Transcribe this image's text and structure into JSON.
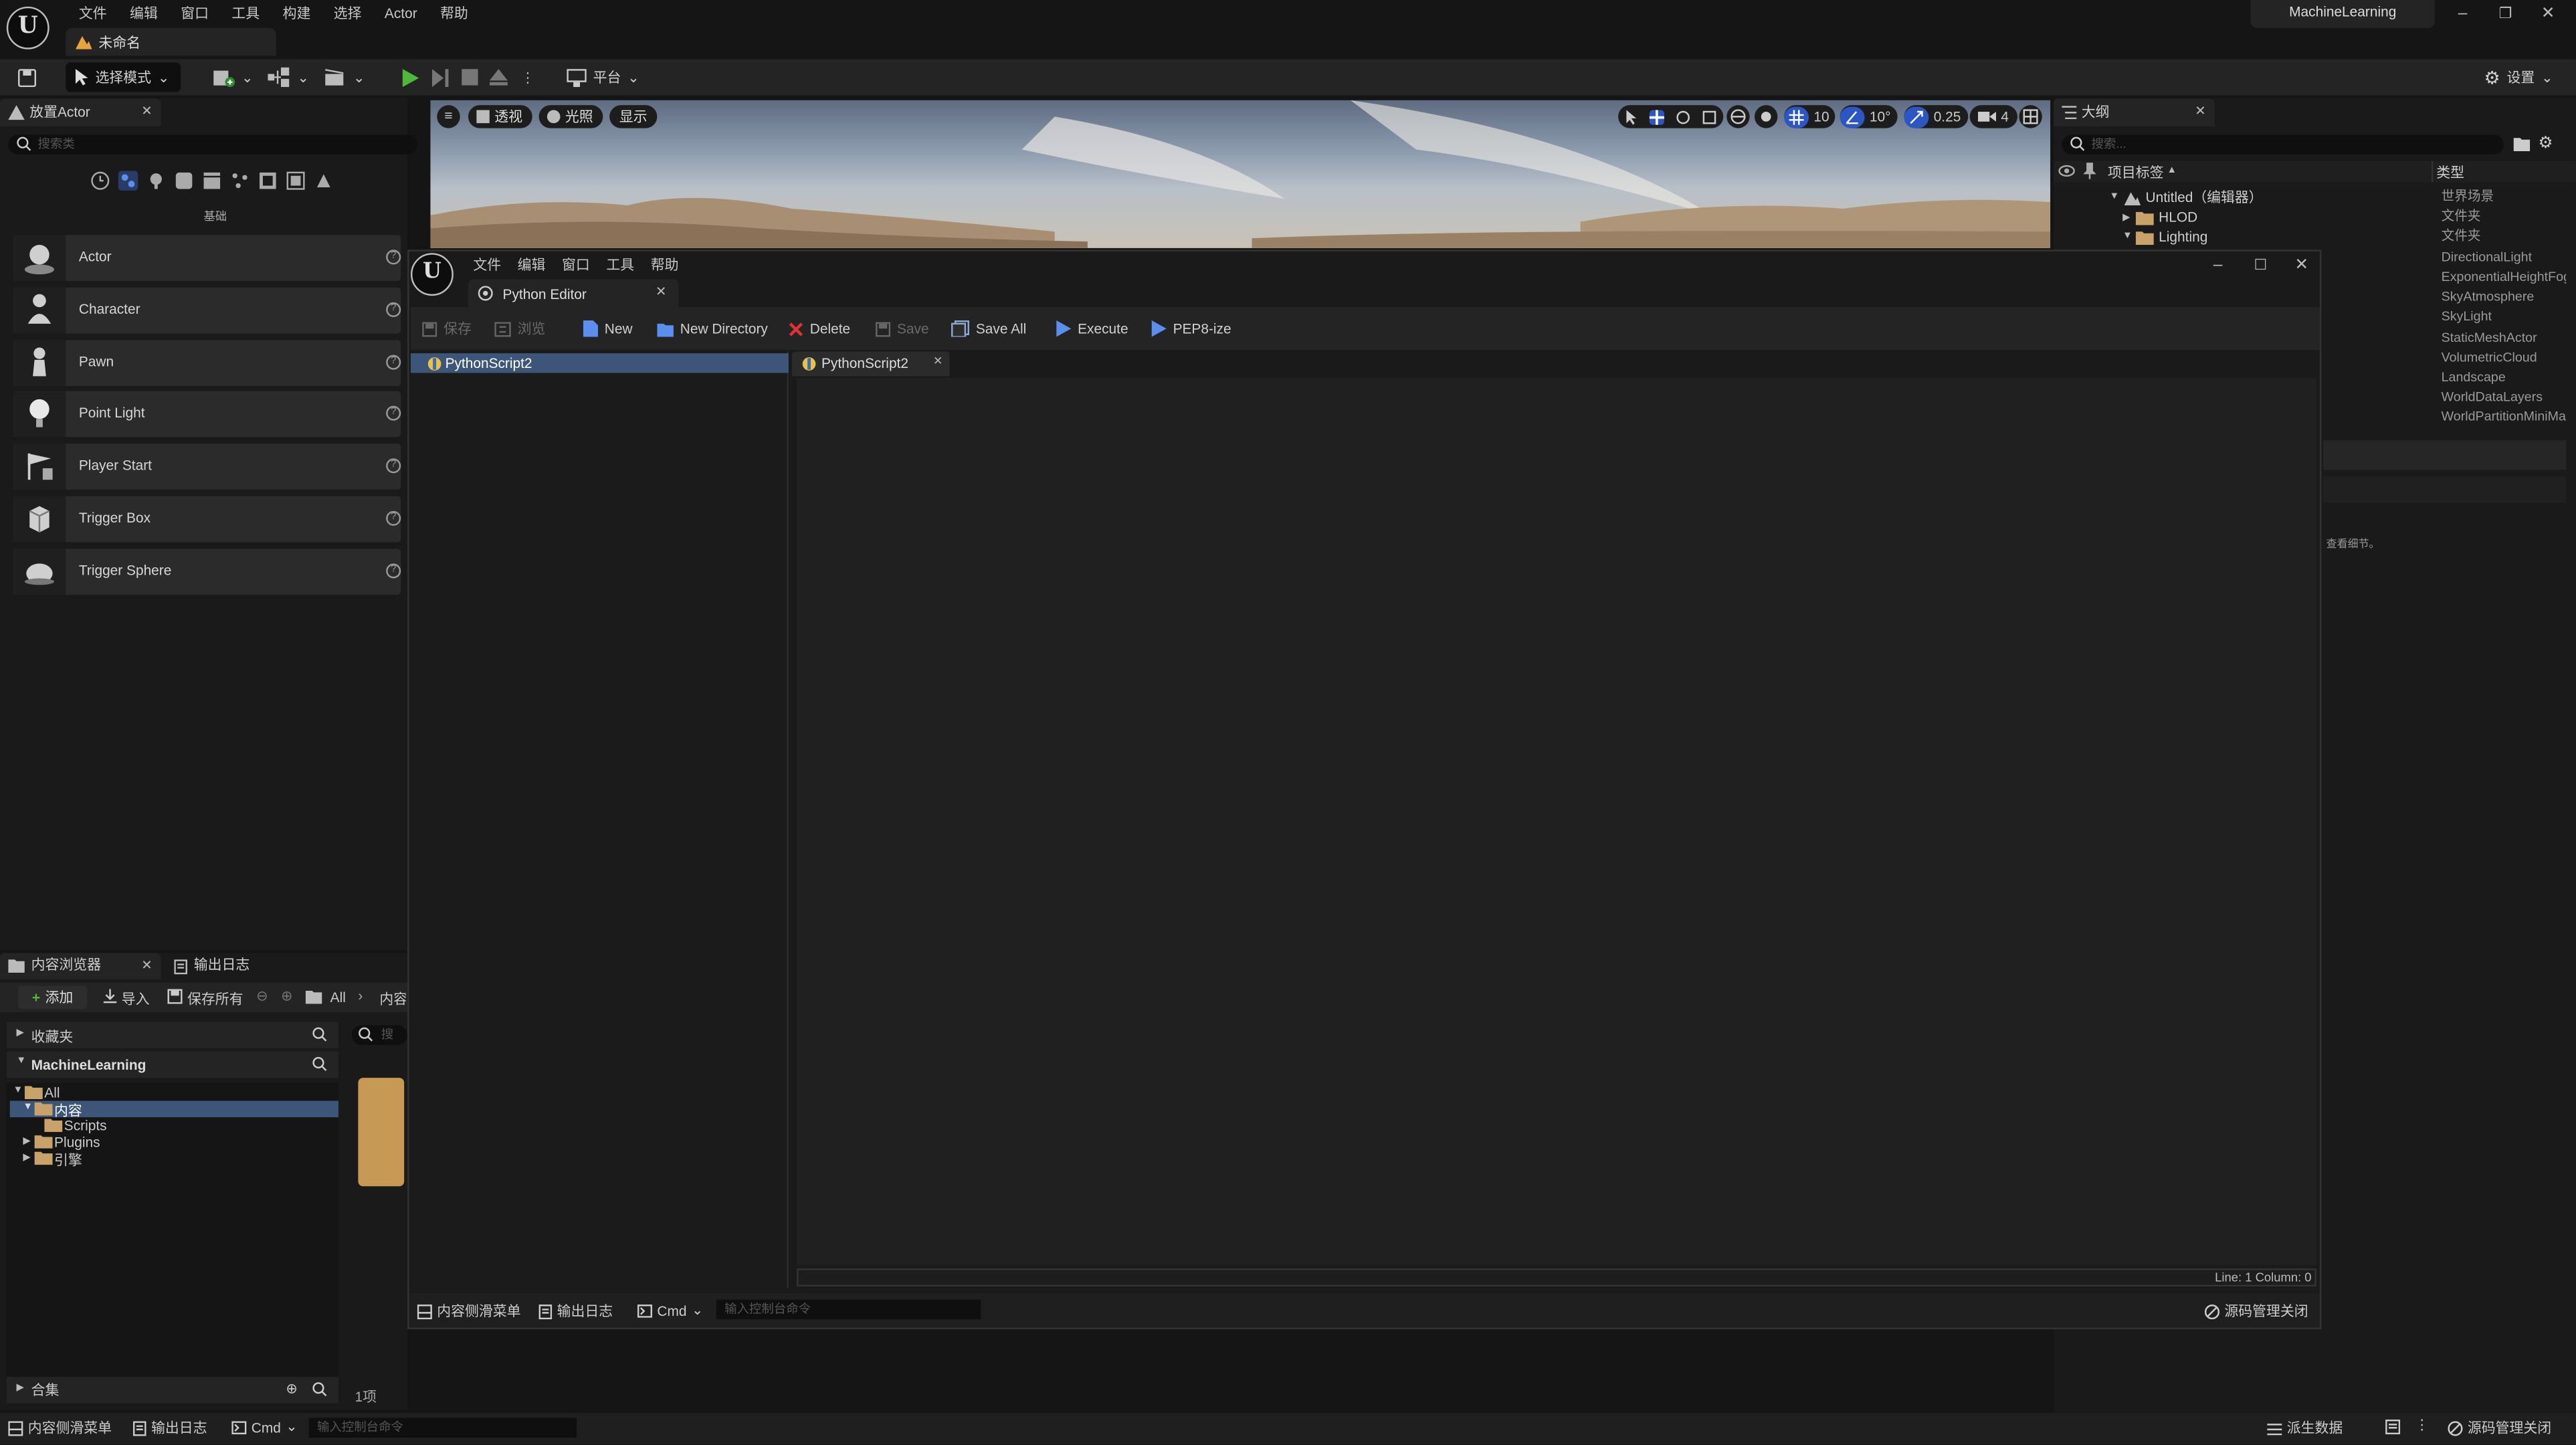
{
  "app": {
    "project_name": "MachineLearning",
    "doc_tab": "未命名"
  },
  "menu": [
    "文件",
    "编辑",
    "窗口",
    "工具",
    "构建",
    "选择",
    "Actor",
    "帮助"
  ],
  "toolbar": {
    "mode": "选择模式",
    "platform": "平台",
    "settings": "设置"
  },
  "place_actors": {
    "tab": "放置Actor",
    "search_placeholder": "搜索类",
    "category": "基础",
    "items": [
      "Actor",
      "Character",
      "Pawn",
      "Point Light",
      "Player Start",
      "Trigger Box",
      "Trigger Sphere"
    ]
  },
  "viewport": {
    "perspective": "透视",
    "lit": "光照",
    "show": "显示",
    "grid": "10",
    "angle": "10°",
    "scale": "0.25",
    "camera": "4"
  },
  "outliner": {
    "tab": "大纲",
    "search_placeholder": "搜索...",
    "col_label": "项目标签",
    "col_type": "类型",
    "rows": [
      {
        "label": "Untitled（编辑器）",
        "type": "世界场景"
      },
      {
        "label": "HLOD",
        "type": "文件夹"
      },
      {
        "label": "Lighting",
        "type": "文件夹"
      }
    ],
    "types_more": [
      "DirectionalLight",
      "ExponentialHeightFog",
      "SkyAtmosphere",
      "SkyLight",
      "StaticMeshActor",
      "VolumetricCloud",
      "Landscape",
      "WorldDataLayers",
      "WorldPartitionMiniMap"
    ],
    "details_hint": "查看细节。"
  },
  "content_browser": {
    "tab": "内容浏览器",
    "log_tab": "输出日志",
    "add": "添加",
    "import": "导入",
    "save_all": "保存所有",
    "path_all": "All",
    "path_content": "内容",
    "favorites": "收藏夹",
    "project": "MachineLearning",
    "tree": [
      "All",
      "内容",
      "Scripts",
      "Plugins",
      "引擎"
    ],
    "collections": "合集",
    "count": "1项",
    "search_placeholder": "搜"
  },
  "python_editor": {
    "menu": [
      "文件",
      "编辑",
      "窗口",
      "工具",
      "帮助"
    ],
    "tab": "Python Editor",
    "btn_save_cn": "保存",
    "btn_browse_cn": "浏览",
    "btn_new": "New",
    "btn_new_dir": "New Directory",
    "btn_delete": "Delete",
    "btn_save": "Save",
    "btn_save_all": "Save All",
    "btn_execute": "Execute",
    "btn_pep8": "PEP8-ize",
    "tree_item": "PythonScript2",
    "file_tab": "PythonScript2",
    "status": "Line: 1 Column: 0",
    "bottom_drawer": "内容侧滑菜单",
    "bottom_log": "输出日志",
    "bottom_cmd": "Cmd",
    "bottom_cmd_placeholder": "输入控制台命令",
    "bottom_scc": "源码管理关闭"
  },
  "statusbar": {
    "drawer": "内容侧滑菜单",
    "log": "输出日志",
    "cmd": "Cmd",
    "cmd_placeholder": "输入控制台命令",
    "derived": "派生数据",
    "scc": "源码管理关闭"
  }
}
